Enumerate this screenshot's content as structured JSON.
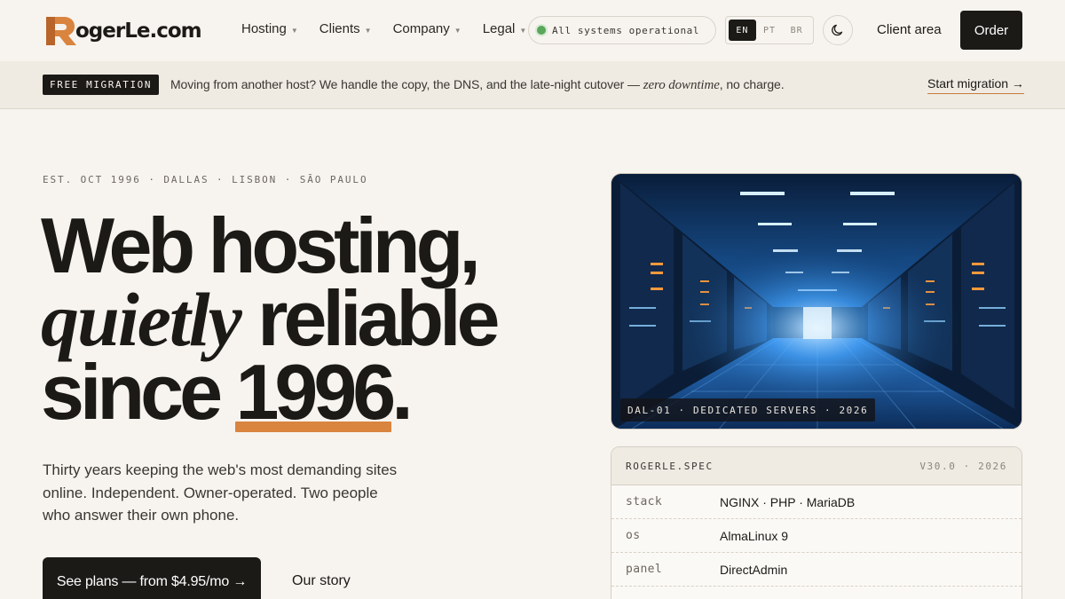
{
  "brand": {
    "name": "RogerLe.com",
    "initial": "R",
    "rest": "ogerLe.com",
    "accent_color": "#d9843f"
  },
  "nav": {
    "items": [
      {
        "label": "Hosting"
      },
      {
        "label": "Clients"
      },
      {
        "label": "Company"
      },
      {
        "label": "Legal"
      }
    ],
    "status_text": "All systems operational",
    "status_color": "#5aa65a",
    "languages": [
      "EN",
      "PT",
      "BR"
    ],
    "active_language": "EN",
    "theme_icon": "moon-icon",
    "client_area": "Client area",
    "order": "Order"
  },
  "banner": {
    "badge": "FREE MIGRATION",
    "text_before": "Moving from another host? We handle the copy, the DNS, and the late-night cutover — ",
    "text_emphasis": "zero downtime",
    "text_after": ", no charge.",
    "link": "Start migration →"
  },
  "hero": {
    "eyebrow": "EST. OCT 1996 · DALLAS · LISBON · SÃO PAULO",
    "line1": "Web hosting,",
    "line2_italic": "quietly",
    "line2_rest": " reliable",
    "line3_start": "since ",
    "line3_year": "1996",
    "line3_end": ".",
    "subtitle": "Thirty years keeping the web's most demanding sites online. Independent. Owner-operated. Two people who answer their own phone.",
    "cta_primary": "See plans — from $4.95/mo →",
    "cta_secondary": "Our story"
  },
  "image": {
    "caption": "DAL-01 · DEDICATED SERVERS · 2026",
    "alt": "Server room corridor"
  },
  "spec": {
    "title": "ROGERLE.SPEC",
    "version": "V30.0 · 2026",
    "rows": [
      {
        "key": "stack",
        "value": "NGINX · PHP · MariaDB"
      },
      {
        "key": "os",
        "value": "AlmaLinux 9"
      },
      {
        "key": "panel",
        "value": "DirectAdmin"
      }
    ]
  }
}
